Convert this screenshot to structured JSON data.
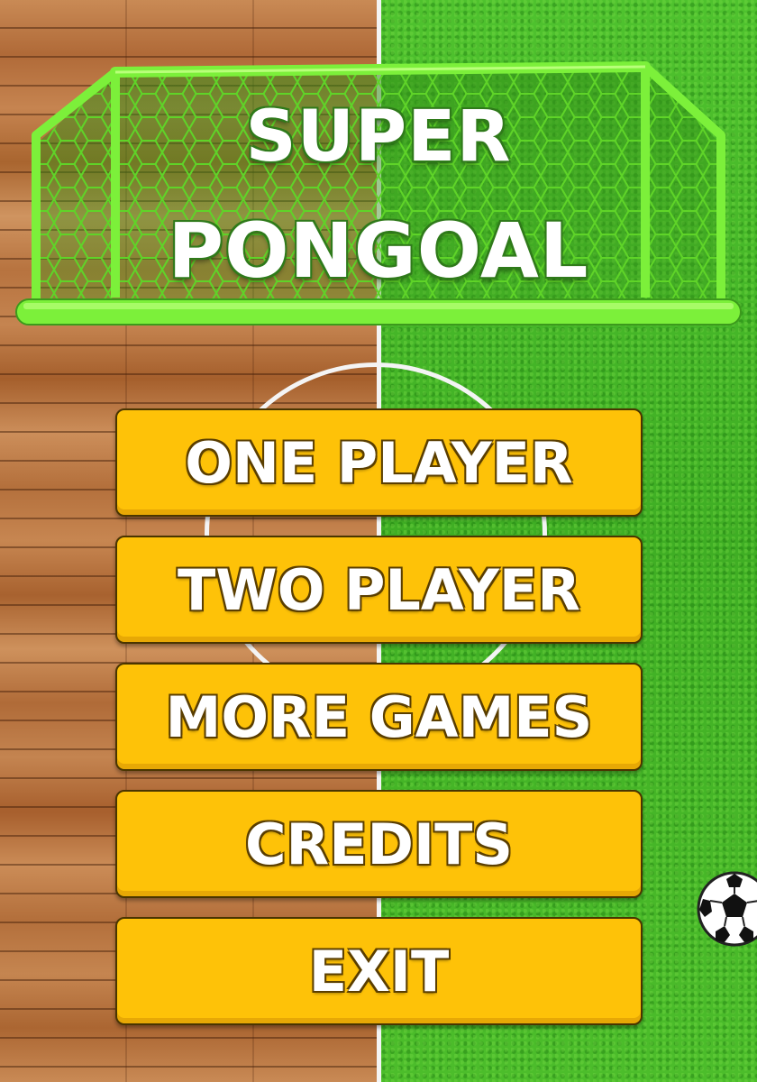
{
  "game": {
    "title_line1": "SUPER",
    "title_line2": "PONGOAL"
  },
  "menu": {
    "buttons": [
      {
        "label": "ONE PLAYER",
        "id": "one-player"
      },
      {
        "label": "TWO PLAYER",
        "id": "two-player"
      },
      {
        "label": "MORE GAMES",
        "id": "more-games"
      },
      {
        "label": "CREDITS",
        "id": "credits"
      },
      {
        "label": "EXIT",
        "id": "exit"
      }
    ]
  },
  "colors": {
    "button_fill": "#fec208",
    "button_border": "#4a3500",
    "goal_frame": "#7cf03a",
    "grass": "#48b82a",
    "wood": "#b5713d",
    "field_lines": "#f4f4f4"
  },
  "icons": {
    "ball": "soccer-ball-icon",
    "goal": "goal-net-icon"
  }
}
